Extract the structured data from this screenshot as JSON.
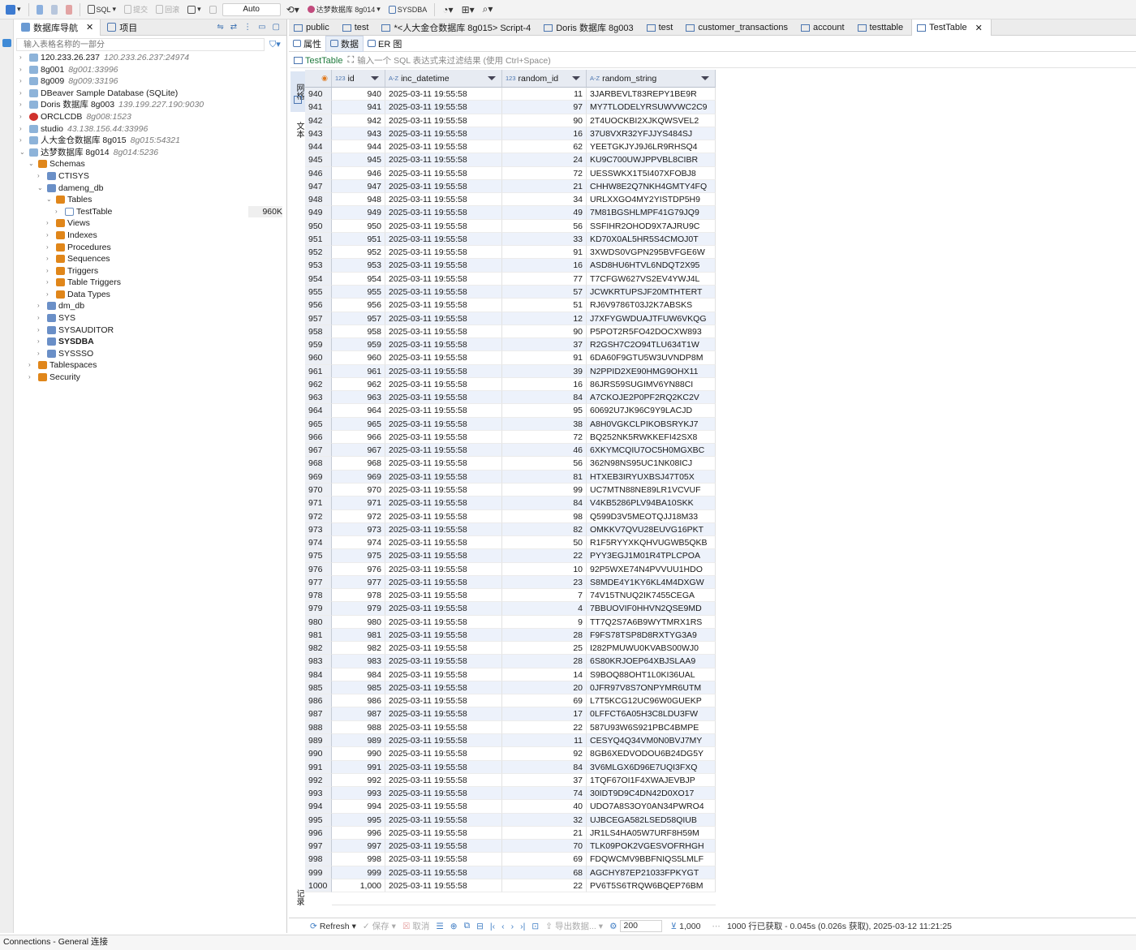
{
  "toolbar": {
    "sql_label": "SQL",
    "commit_label": "提交",
    "rollback_label": "回滚",
    "mode_value": "Auto",
    "datasource": "达梦数据库 8g014",
    "schema": "SYSDBA"
  },
  "navigator": {
    "tab_db": "数据库导航",
    "tab_project": "项目",
    "filter_placeholder": "输入表格名称的一部分",
    "nodes": [
      {
        "label": "120.233.26.237",
        "sub": "120.233.26.237:24974",
        "level": 0,
        "arrow": "›",
        "icon": "conn"
      },
      {
        "label": "8g001",
        "sub": "8g001:33996",
        "level": 0,
        "arrow": "›",
        "icon": "conn"
      },
      {
        "label": "8g009",
        "sub": "8g009:33196",
        "level": 0,
        "arrow": "›",
        "icon": "conn"
      },
      {
        "label": "DBeaver Sample Database (SQLite)",
        "sub": "",
        "level": 0,
        "arrow": "›",
        "icon": "conn"
      },
      {
        "label": "Doris 数据库 8g003",
        "sub": "139.199.227.190:9030",
        "level": 0,
        "arrow": "›",
        "icon": "conn"
      },
      {
        "label": "ORCLCDB",
        "sub": "8g008:1523",
        "level": 0,
        "arrow": "›",
        "icon": "oracle"
      },
      {
        "label": "studio",
        "sub": "43.138.156.44:33996",
        "level": 0,
        "arrow": "›",
        "icon": "conn"
      },
      {
        "label": "人大金仓数据库 8g015",
        "sub": "8g015:54321",
        "level": 0,
        "arrow": "›",
        "icon": "conn"
      },
      {
        "label": "达梦数据库 8g014",
        "sub": "8g014:5236",
        "level": 0,
        "arrow": "⌄",
        "icon": "conn"
      },
      {
        "label": "Schemas",
        "sub": "",
        "level": 1,
        "arrow": "⌄",
        "icon": "folder"
      },
      {
        "label": "CTISYS",
        "sub": "",
        "level": 2,
        "arrow": "›",
        "icon": "schema"
      },
      {
        "label": "dameng_db",
        "sub": "",
        "level": 2,
        "arrow": "⌄",
        "icon": "schema"
      },
      {
        "label": "Tables",
        "sub": "",
        "level": 3,
        "arrow": "⌄",
        "icon": "folder"
      },
      {
        "label": "TestTable",
        "sub": "",
        "level": 4,
        "arrow": "›",
        "icon": "table",
        "size": "960K"
      },
      {
        "label": "Views",
        "sub": "",
        "level": 3,
        "arrow": "›",
        "icon": "folder"
      },
      {
        "label": "Indexes",
        "sub": "",
        "level": 3,
        "arrow": "›",
        "icon": "folder"
      },
      {
        "label": "Procedures",
        "sub": "",
        "level": 3,
        "arrow": "›",
        "icon": "folder"
      },
      {
        "label": "Sequences",
        "sub": "",
        "level": 3,
        "arrow": "›",
        "icon": "folder"
      },
      {
        "label": "Triggers",
        "sub": "",
        "level": 3,
        "arrow": "›",
        "icon": "folder"
      },
      {
        "label": "Table Triggers",
        "sub": "",
        "level": 3,
        "arrow": "›",
        "icon": "folder"
      },
      {
        "label": "Data Types",
        "sub": "",
        "level": 3,
        "arrow": "›",
        "icon": "folder"
      },
      {
        "label": "dm_db",
        "sub": "",
        "level": 2,
        "arrow": "›",
        "icon": "schema"
      },
      {
        "label": "SYS",
        "sub": "",
        "level": 2,
        "arrow": "›",
        "icon": "schema"
      },
      {
        "label": "SYSAUDITOR",
        "sub": "",
        "level": 2,
        "arrow": "›",
        "icon": "schema"
      },
      {
        "label": "SYSDBA",
        "sub": "",
        "level": 2,
        "arrow": "›",
        "icon": "schema",
        "bold": true
      },
      {
        "label": "SYSSSO",
        "sub": "",
        "level": 2,
        "arrow": "›",
        "icon": "schema"
      },
      {
        "label": "Tablespaces",
        "sub": "",
        "level": 1,
        "arrow": "›",
        "icon": "folder"
      },
      {
        "label": "Security",
        "sub": "",
        "level": 1,
        "arrow": "›",
        "icon": "folder"
      }
    ]
  },
  "editor_tabs": [
    "public",
    "test",
    "*<人大金仓数据库 8g015> Script-4",
    "Doris 数据库 8g003",
    "test",
    "customer_transactions",
    "account",
    "testtable",
    "TestTable"
  ],
  "sub_tabs": {
    "properties": "属性",
    "data": "数据",
    "er": "ER 图"
  },
  "filter": {
    "table_name": "TestTable",
    "placeholder": "输入一个 SQL 表达式来过滤结果 (使用 Ctrl+Space)"
  },
  "side_tabs": {
    "grid": "网格",
    "text": "文本",
    "record": "记录"
  },
  "grid": {
    "columns": [
      {
        "type": "123",
        "name": "id"
      },
      {
        "type": "A-Z",
        "name": "inc_datetime"
      },
      {
        "type": "123",
        "name": "random_id"
      },
      {
        "type": "A-Z",
        "name": "random_string"
      }
    ],
    "datetime": "2025-03-11 19:55:58",
    "rows": [
      [
        "940",
        "940",
        "11",
        "3JARBEVLT83REPY1BE9R"
      ],
      [
        "941",
        "941",
        "97",
        "MY7TLODELYRSUWVWC2C9"
      ],
      [
        "942",
        "942",
        "90",
        "2T4UOCKBI2XJKQWSVEL2"
      ],
      [
        "943",
        "943",
        "16",
        "37U8VXR32YFJJYS484SJ"
      ],
      [
        "944",
        "944",
        "62",
        "YEETGKJYJ9J6LR9RHSQ4"
      ],
      [
        "945",
        "945",
        "24",
        "KU9C700UWJPPVBL8CIBR"
      ],
      [
        "946",
        "946",
        "72",
        "UESSWKX1T5I407XFOBJ8"
      ],
      [
        "947",
        "947",
        "21",
        "CHHW8E2Q7NKH4GMTY4FQ"
      ],
      [
        "948",
        "948",
        "34",
        "URLXXGO4MY2YISTDP5H9"
      ],
      [
        "949",
        "949",
        "49",
        "7M81BGSHLMPF41G79JQ9"
      ],
      [
        "950",
        "950",
        "56",
        "SSFIHR2OHOD9X7AJRU9C"
      ],
      [
        "951",
        "951",
        "33",
        "KD70X0AL5HR5S4CMOJ0T"
      ],
      [
        "952",
        "952",
        "91",
        "3XWDS0VGPN295BVFGE6W"
      ],
      [
        "953",
        "953",
        "16",
        "ASD8HU6HTVL6NDQT2X95"
      ],
      [
        "954",
        "954",
        "77",
        "T7CFGW627VS2EV4YWJ4L"
      ],
      [
        "955",
        "955",
        "57",
        "JCWKRTUPSJF20MTHTERT"
      ],
      [
        "956",
        "956",
        "51",
        "RJ6V9786T03J2K7ABSKS"
      ],
      [
        "957",
        "957",
        "12",
        "J7XFYGWDUAJTFUW6VKQG"
      ],
      [
        "958",
        "958",
        "90",
        "P5POT2R5FO42DOCXW893"
      ],
      [
        "959",
        "959",
        "37",
        "R2GSH7C2O94TLU634T1W"
      ],
      [
        "960",
        "960",
        "91",
        "6DA60F9GTU5W3UVNDP8M"
      ],
      [
        "961",
        "961",
        "39",
        "N2PPID2XE90HMG9OHX11"
      ],
      [
        "962",
        "962",
        "16",
        "86JRS59SUGIMV6YN88CI"
      ],
      [
        "963",
        "963",
        "84",
        "A7CKOJE2P0PF2RQ2KC2V"
      ],
      [
        "964",
        "964",
        "95",
        "60692U7JK96C9Y9LACJD"
      ],
      [
        "965",
        "965",
        "38",
        "A8H0VGKCLPIKOBSRYKJ7"
      ],
      [
        "966",
        "966",
        "72",
        "BQ252NK5RWKKEFI42SX8"
      ],
      [
        "967",
        "967",
        "46",
        "6XKYMCQIU7OC5H0MGXBC"
      ],
      [
        "968",
        "968",
        "56",
        "362N98NS95UC1NK08ICJ"
      ],
      [
        "969",
        "969",
        "81",
        "HTXEB3IRYUXBSJ47T05X"
      ],
      [
        "970",
        "970",
        "99",
        "UC7MTN88NE89LR1VCVUF"
      ],
      [
        "971",
        "971",
        "84",
        "V4KB5286PLV94BA10SKK"
      ],
      [
        "972",
        "972",
        "98",
        "Q599D3V5MEOTQJJ18M33"
      ],
      [
        "973",
        "973",
        "82",
        "OMKKV7QVU28EUVG16PKT"
      ],
      [
        "974",
        "974",
        "50",
        "R1F5RYYXKQHVUGWB5QKB"
      ],
      [
        "975",
        "975",
        "22",
        "PYY3EGJ1M01R4TPLCPOA"
      ],
      [
        "976",
        "976",
        "10",
        "92P5WXE74N4PVVUU1HDO"
      ],
      [
        "977",
        "977",
        "23",
        "S8MDE4Y1KY6KL4M4DXGW"
      ],
      [
        "978",
        "978",
        "7",
        "74V15TNUQ2IK7455CEGA"
      ],
      [
        "979",
        "979",
        "4",
        "7BBUOVIF0HHVN2QSE9MD"
      ],
      [
        "980",
        "980",
        "9",
        "TT7Q2S7A6B9WYTMRX1RS"
      ],
      [
        "981",
        "981",
        "28",
        "F9FS78TSP8D8RXTYG3A9"
      ],
      [
        "982",
        "982",
        "25",
        "I282PMUWU0KVABS00WJ0"
      ],
      [
        "983",
        "983",
        "28",
        "6S80KRJOEP64XBJSLAA9"
      ],
      [
        "984",
        "984",
        "14",
        "S9BOQ88OHT1L0KI36UAL"
      ],
      [
        "985",
        "985",
        "20",
        "0JFR97V8S7ONPYMR6UTM"
      ],
      [
        "986",
        "986",
        "69",
        "L7T5KCG12UC96W0GUEKP"
      ],
      [
        "987",
        "987",
        "17",
        "0LFFCT6A05H3C8LDU3FW"
      ],
      [
        "988",
        "988",
        "22",
        "587U93W6S921PBC4BMPE"
      ],
      [
        "989",
        "989",
        "11",
        "CESYQ4Q34VM0N0BVJ7MY"
      ],
      [
        "990",
        "990",
        "92",
        "8GB6XEDVODOU6B24DG5Y"
      ],
      [
        "991",
        "991",
        "84",
        "3V6MLGX6D96E7UQI3FXQ"
      ],
      [
        "992",
        "992",
        "37",
        "1TQF67OI1F4XWAJEVBJP"
      ],
      [
        "993",
        "993",
        "74",
        "30IDT9D9C4DN42D0XO17"
      ],
      [
        "994",
        "994",
        "40",
        "UDO7A8S3OY0AN34PWRO4"
      ],
      [
        "995",
        "995",
        "32",
        "UJBCEGA582LSED58QIUB"
      ],
      [
        "996",
        "996",
        "21",
        "JR1LS4HA05W7URF8H59M"
      ],
      [
        "997",
        "997",
        "70",
        "TLK09POK2VGESVOFRHGH"
      ],
      [
        "998",
        "998",
        "69",
        "FDQWCMV9BBFNIQS5LMLF"
      ],
      [
        "999",
        "999",
        "68",
        "AGCHY87EP21033FPKYGT"
      ],
      [
        "1000",
        "1,000",
        "22",
        "PV6T5S6TRQW6BQEP76BM"
      ]
    ]
  },
  "status": {
    "refresh": "Refresh",
    "save": "保存",
    "cancel": "取消",
    "export": "导出数据...",
    "fetch_size": "200",
    "row_count": "1,000",
    "summary": "1000 行已获取 - 0.045s (0.026s 获取), 2025-03-12 11:21:25"
  },
  "app_status": "Connections - General 连接",
  "colors": {
    "accent": "#4c76b0",
    "folder": "#e0861a",
    "alt_row": "#edf2fb"
  }
}
